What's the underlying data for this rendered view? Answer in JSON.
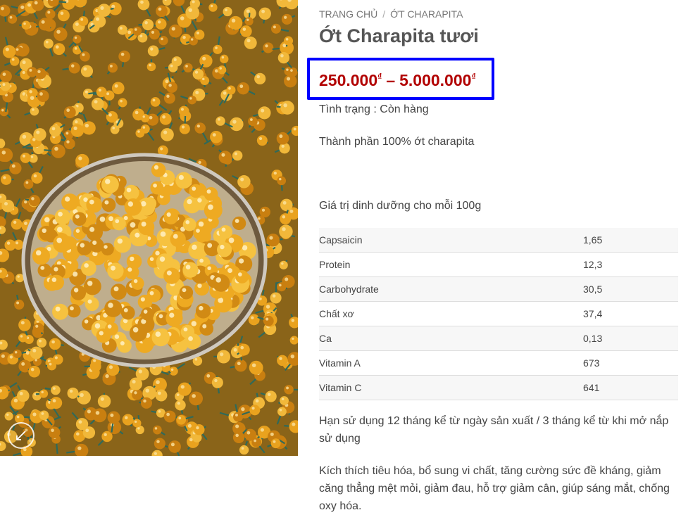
{
  "product_image": {
    "subject": "orange charapita peppers"
  },
  "zoom_button": {
    "icon": "expand-arrows-icon"
  },
  "breadcrumb": {
    "home": "TRANG CHỦ",
    "separator": "/",
    "category": "ỚT CHARAPITA"
  },
  "product": {
    "title": "Ớt Charapita tươi",
    "price_min": "250.000",
    "price_max": "5.000.000",
    "currency": "₫",
    "price_dash": "–",
    "stock": "Tình trạng : Còn hàng",
    "ingredients": "Thành phần 100% ớt charapita",
    "nutrition_heading": "Giá trị dinh dưỡng cho mỗi 100g",
    "nutrition": [
      {
        "name": "Capsaicin",
        "value": "1,65"
      },
      {
        "name": "Protein",
        "value": "12,3"
      },
      {
        "name": "Carbohydrate",
        "value": "30,5"
      },
      {
        "name": "Chất xơ",
        "value": "37,4"
      },
      {
        "name": "Ca",
        "value": "0,13"
      },
      {
        "name": "Vitamin A",
        "value": "673"
      },
      {
        "name": "Vitamin C",
        "value": "641"
      }
    ],
    "shelf_life": "Hạn sử dụng 12 tháng kể từ ngày sản xuất / 3 tháng kể từ khi mở nắp sử dụng",
    "benefits": "Kích thích tiêu hóa, bổ sung vi chất, tăng cường sức đề kháng, giảm căng thẳng mệt mỏi, giảm đau, hỗ trợ giảm cân, giúp sáng mắt, chống oxy hóa."
  },
  "colors": {
    "price": "#b20000",
    "highlight_border": "#0000ff",
    "pepper": "#e9a21e",
    "stem": "#2f6a5a"
  }
}
